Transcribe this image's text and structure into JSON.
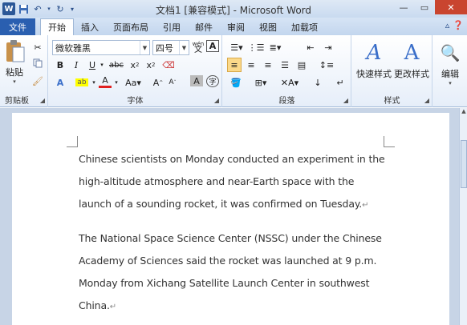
{
  "titlebar": {
    "title": "文档1 [兼容模式] - Microsoft Word",
    "app_icon": "W"
  },
  "tabs": {
    "file": "文件",
    "items": [
      "开始",
      "插入",
      "页面布局",
      "引用",
      "邮件",
      "审阅",
      "视图",
      "加载项"
    ]
  },
  "ribbon": {
    "clipboard": {
      "label": "剪贴板",
      "paste": "粘贴"
    },
    "font": {
      "label": "字体",
      "font_name": "微软雅黑",
      "font_size": "四号",
      "wen": "wén",
      "wen_char": "A"
    },
    "paragraph": {
      "label": "段落"
    },
    "styles": {
      "label": "样式",
      "quick_styles": "快速样式",
      "change_styles": "更改样式"
    },
    "editing": {
      "label": "编辑"
    }
  },
  "document": {
    "paragraphs": [
      {
        "lines": [
          "Chinese scientists on Monday conducted an experiment in the",
          "high-altitude atmosphere and near-Earth space with the",
          "launch of a sounding rocket, it was confirmed on Tuesday."
        ]
      },
      {
        "lines": [
          "The National Space Science Center (NSSC) under the Chinese",
          "Academy of Sciences said the rocket was launched at 9 p.m.",
          "Monday from Xichang Satellite Launch Center in southwest",
          "China."
        ]
      }
    ],
    "paragraph_mark": "↵"
  },
  "colors": {
    "file_tab": "#2a5fb0",
    "highlight": "#ffff00",
    "font_color": "#e02020",
    "close_button": "#c9452f"
  }
}
